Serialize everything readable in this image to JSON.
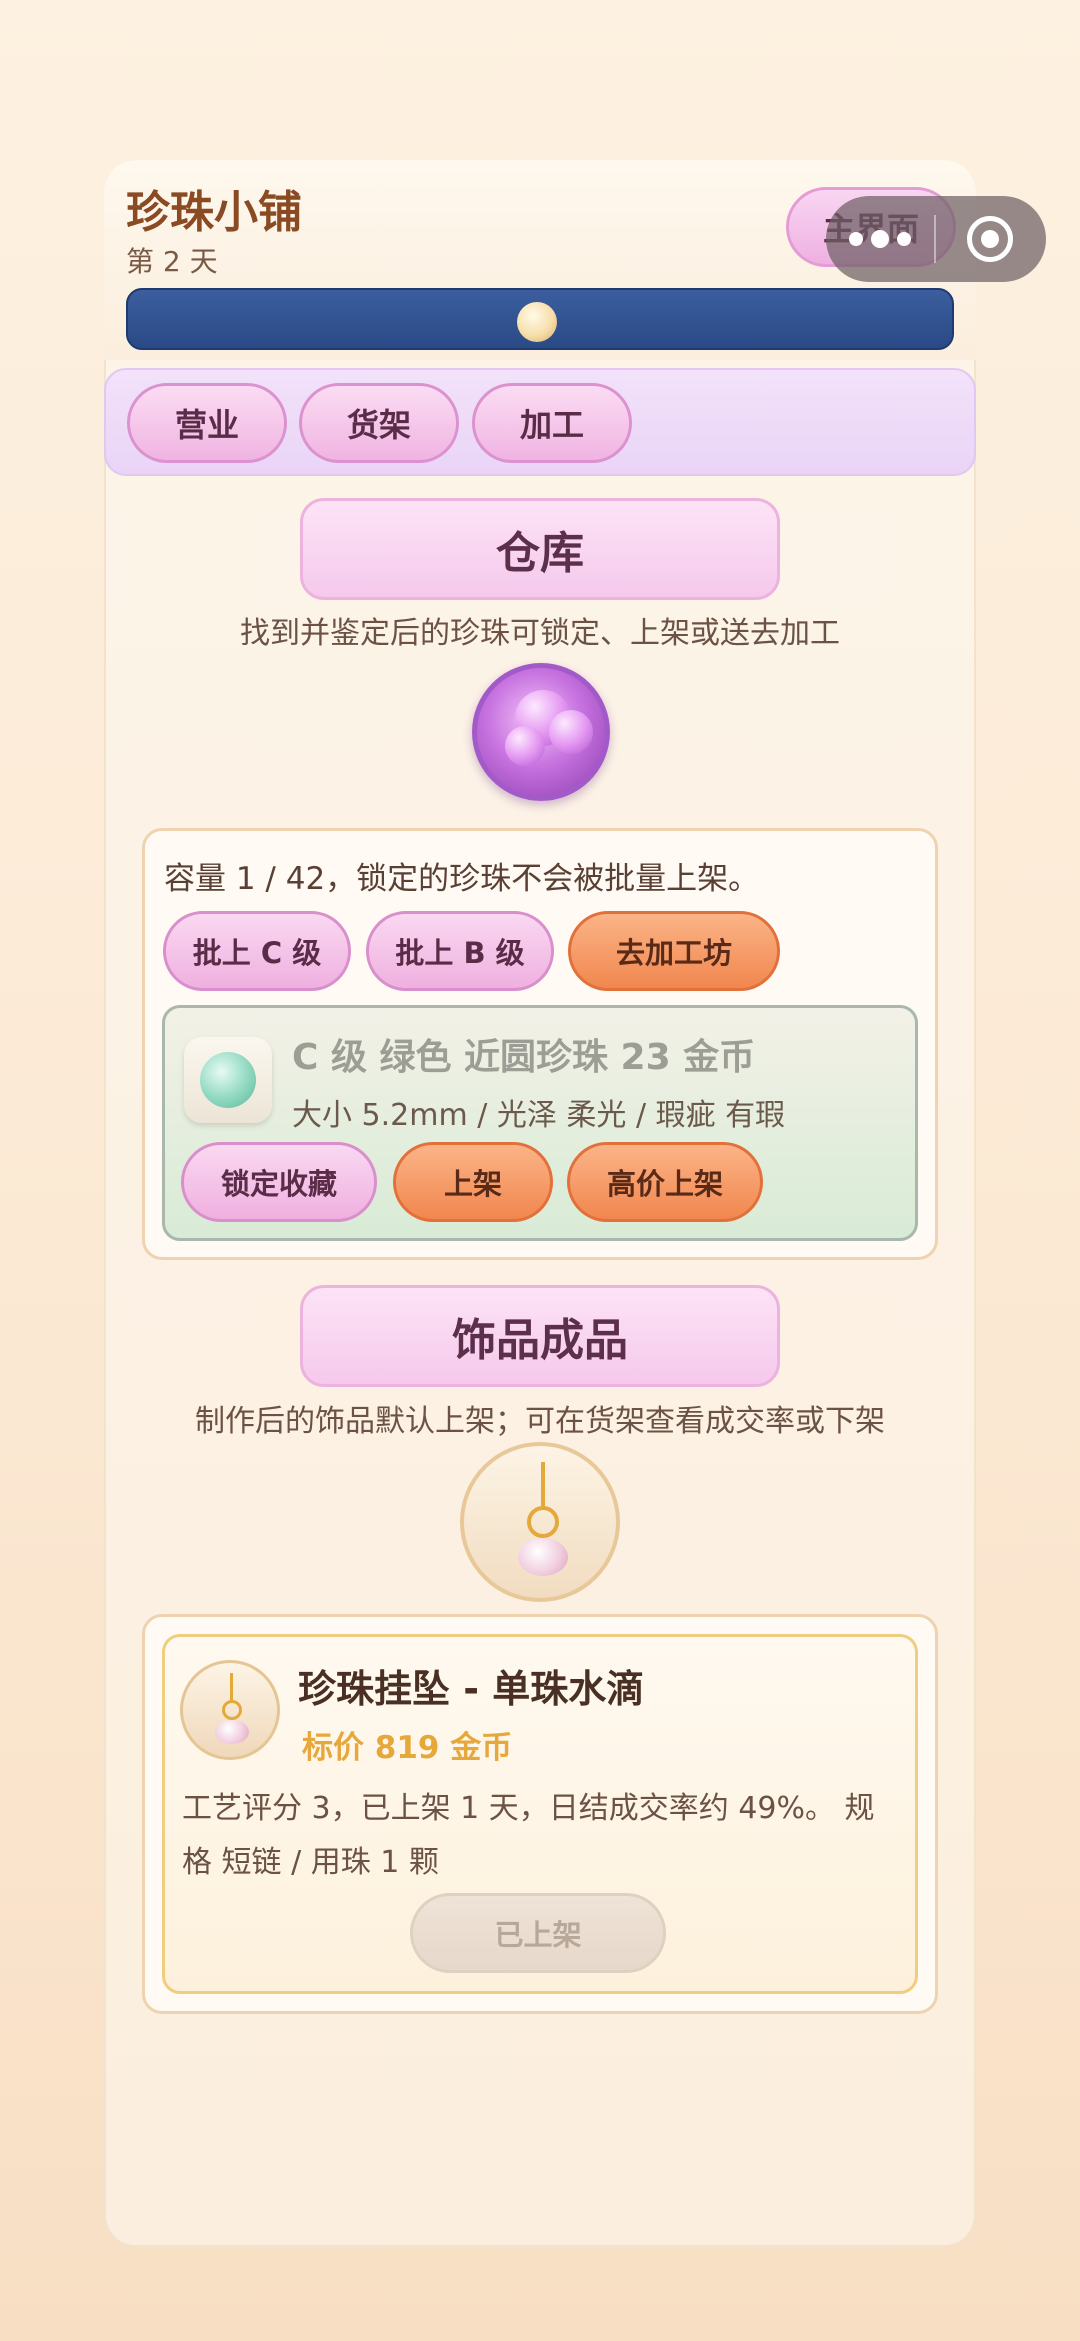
{
  "header": {
    "shop_title": "珍珠小铺",
    "day_label": "第 2 天",
    "main_menu_button": "主界面"
  },
  "tabs": [
    {
      "label": "营业"
    },
    {
      "label": "货架"
    },
    {
      "label": "加工"
    }
  ],
  "warehouse": {
    "title": "仓库",
    "description": "找到并鉴定后的珍珠可锁定、上架或送去加工",
    "capacity_text": "容量 1 / 42，锁定的珍珠不会被批量上架。",
    "bulk_c_button": "批上 C 级",
    "bulk_b_button": "批上 B 级",
    "workshop_button": "去加工坊",
    "pearl": {
      "name": "C 级 绿色 近圆珍珠  23 金币",
      "spec": "大小 5.2mm / 光泽 柔光 / 瑕疵 有瑕",
      "lock_button": "锁定收藏",
      "list_button": "上架",
      "premium_list_button": "高价上架"
    }
  },
  "accessories": {
    "title": "饰品成品",
    "description": "制作后的饰品默认上架；可在货架查看成交率或下架",
    "product": {
      "name": "珍珠挂坠 - 单珠水滴",
      "price": "标价 819 金币",
      "description": "工艺评分 3，已上架 1 天，日结成交率约 49%。  规格 短链 / 用珠 1 颗",
      "status_button": "已上架"
    }
  },
  "icons": {
    "capsule_more": "more-dots-icon",
    "capsule_close": "target-close-icon",
    "warehouse_emblem": "purple-pearls-emblem-icon",
    "pearl_thumbnail": "green-pearl-icon",
    "pendant_emblem": "pendant-icon"
  },
  "colors": {
    "accent_pink": "#f0b4e2",
    "accent_orange": "#f1874f",
    "progress_blue": "#2a4a86",
    "price_gold": "#e6a83a"
  }
}
